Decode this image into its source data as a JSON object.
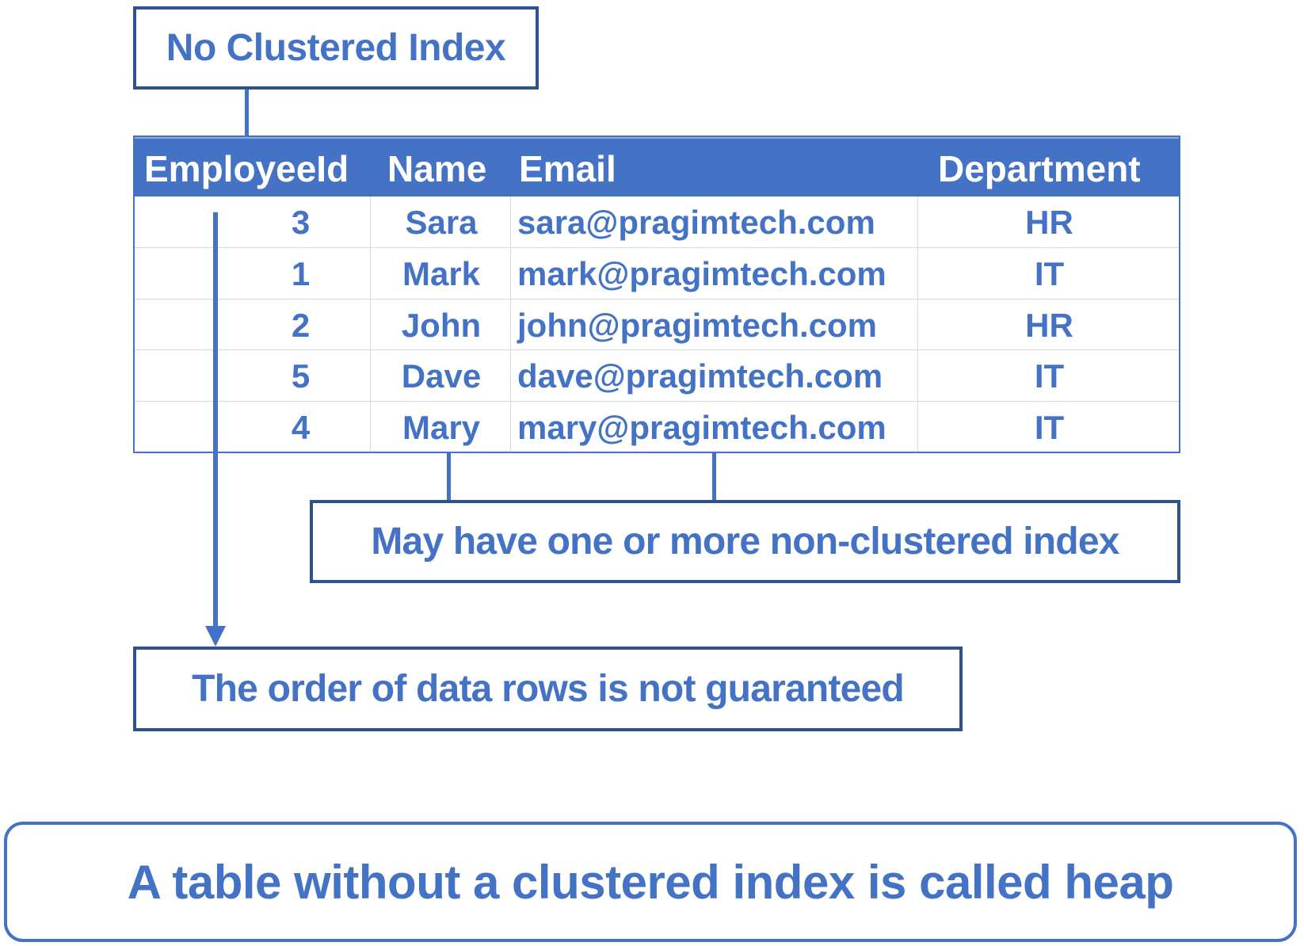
{
  "labels": {
    "no_clustered_index": "No Clustered Index",
    "non_clustered": "May have one or more non-clustered index",
    "order_not_guaranteed": "The order of data rows is not guaranteed",
    "heap_definition": "A table without a clustered index is called heap"
  },
  "table": {
    "headers": [
      "EmployeeId",
      "Name",
      "Email",
      "Department"
    ],
    "rows": [
      {
        "id": "3",
        "name": "Sara",
        "email": "sara@pragimtech.com",
        "dept": "HR"
      },
      {
        "id": "1",
        "name": "Mark",
        "email": "mark@pragimtech.com",
        "dept": "IT"
      },
      {
        "id": "2",
        "name": "John",
        "email": "john@pragimtech.com",
        "dept": "HR"
      },
      {
        "id": "5",
        "name": "Dave",
        "email": "dave@pragimtech.com",
        "dept": "IT"
      },
      {
        "id": "4",
        "name": "Mary",
        "email": "mary@pragimtech.com",
        "dept": "IT"
      }
    ]
  },
  "colors": {
    "accent": "#4472c4",
    "box_border": "#2f528f",
    "grid": "#d9d9d9"
  }
}
